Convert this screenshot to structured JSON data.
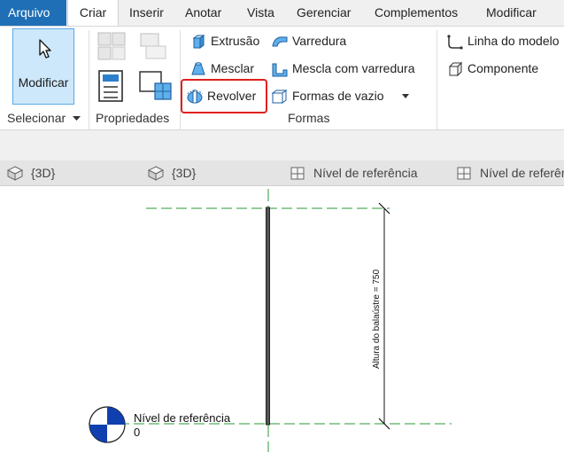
{
  "menu": {
    "tabs": [
      {
        "label": "Arquivo"
      },
      {
        "label": "Criar"
      },
      {
        "label": "Inserir"
      },
      {
        "label": "Anotar"
      },
      {
        "label": "Vista"
      },
      {
        "label": "Gerenciar"
      },
      {
        "label": "Complementos"
      },
      {
        "label": "Modificar"
      }
    ],
    "active_tab": "Criar"
  },
  "ribbon": {
    "modify_label": "Modificar",
    "panels": {
      "select": "Selecionar",
      "properties": "Propriedades",
      "forms": "Formas"
    },
    "forms": {
      "extrusion": "Extrusão",
      "blend": "Mesclar",
      "revolve": "Revolver",
      "sweep": "Varredura",
      "swept_blend": "Mescla com  varredura",
      "void_forms": "Formas de  vazio"
    },
    "model_line": "Linha do  modelo",
    "component": "Componente",
    "highlighted_tool": "Revolver"
  },
  "view_tabs": [
    {
      "label": "{3D}",
      "icon": "3d-view-icon"
    },
    {
      "label": "{3D}",
      "icon": "3d-view-icon"
    },
    {
      "label": "Nível de referência",
      "icon": "elevation-view-icon"
    },
    {
      "label": "Nível de referência",
      "icon": "elevation-view-icon"
    }
  ],
  "canvas": {
    "level_name": "Nível de referência",
    "level_value": "0",
    "dimension_text": "Altura do balaústre = 750",
    "colors": {
      "reference_line": "#2a9a3a",
      "level_marker": "#1040b0",
      "highlight": "#e02020"
    }
  }
}
